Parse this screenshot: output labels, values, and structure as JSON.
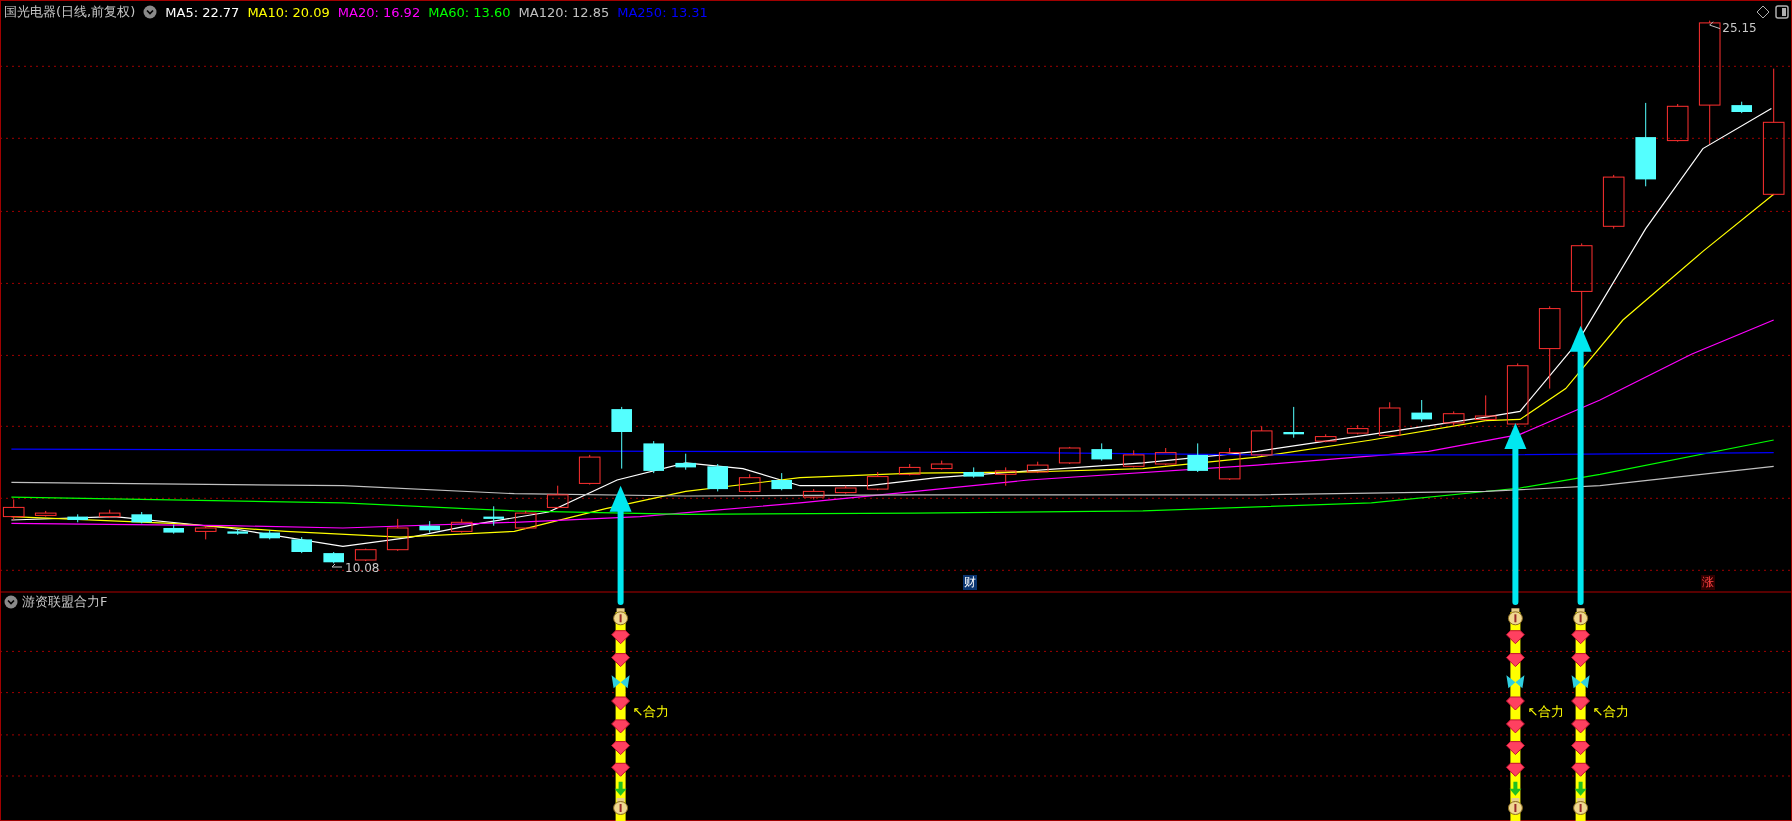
{
  "chart_title": "国光电器(日线,前复权)",
  "legend": [
    {
      "label": "MA5: 22.77",
      "color": "#ffffff"
    },
    {
      "label": "MA10: 20.09",
      "color": "#ffff00"
    },
    {
      "label": "MA20: 16.92",
      "color": "#ff00ff"
    },
    {
      "label": "MA60: 13.60",
      "color": "#00ff00"
    },
    {
      "label": "MA120: 12.85",
      "color": "#c0c0c0"
    },
    {
      "label": "MA250: 13.31",
      "color": "#0000ff"
    }
  ],
  "price_marks": [
    {
      "kind": "high",
      "value": "25.15"
    },
    {
      "kind": "low",
      "value": "10.08"
    }
  ],
  "event_badges": [
    {
      "kind": "info",
      "text": "财"
    },
    {
      "kind": "alert",
      "text": "涨"
    }
  ],
  "indicator": {
    "title": "游资联盟合力F",
    "signals": [
      {
        "label": "↖合力"
      },
      {
        "label": "↖合力"
      },
      {
        "label": "↖合力"
      }
    ]
  }
}
